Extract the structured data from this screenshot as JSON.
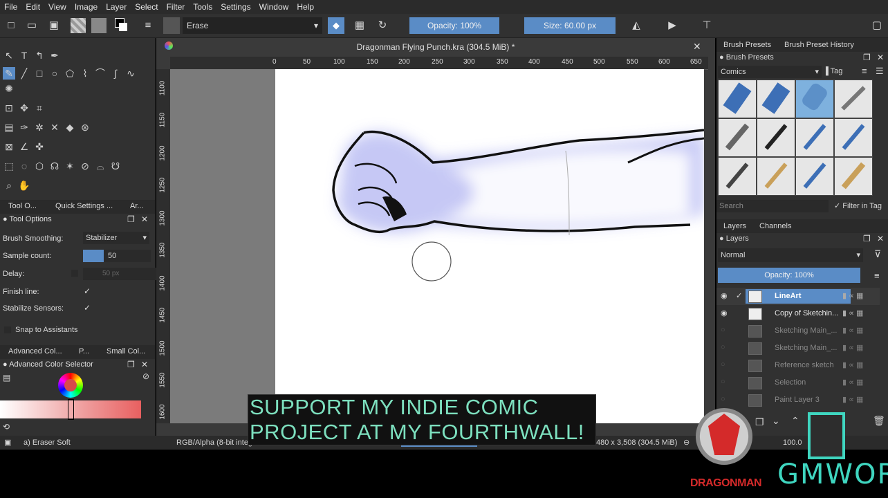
{
  "menu": [
    "File",
    "Edit",
    "View",
    "Image",
    "Layer",
    "Select",
    "Filter",
    "Tools",
    "Settings",
    "Window",
    "Help"
  ],
  "toolbar": {
    "blend_mode": "Erase",
    "opacity": "Opacity: 100%",
    "size_label": "Size:",
    "size_value": "60.00 px"
  },
  "document": {
    "title": "Dragonman Flying Punch.kra (304.5 MiB) *"
  },
  "rulers": {
    "h_ticks": [
      "0",
      "50",
      "100",
      "150",
      "200",
      "250",
      "300",
      "350",
      "400",
      "450",
      "500",
      "550",
      "600",
      "650"
    ],
    "v_ticks": [
      "1100",
      "1150",
      "1200",
      "1250",
      "1300",
      "1350",
      "1400",
      "1450",
      "1500",
      "1550",
      "1600"
    ]
  },
  "left_panel": {
    "tabs": [
      "Tool O...",
      "Quick Settings ...",
      "Ar..."
    ],
    "tool_options_title": "Tool Options",
    "brush_smoothing_label": "Brush Smoothing:",
    "brush_smoothing_value": "Stabilizer",
    "sample_count_label": "Sample count:",
    "sample_count_value": "50",
    "delay_label": "Delay:",
    "delay_value": "50 px",
    "finish_line_label": "Finish line:",
    "stabilize_sensors_label": "Stabilize Sensors:",
    "snap_label": "Snap to Assistants",
    "color_tabs": [
      "Advanced Col...",
      "P...",
      "Small Col..."
    ],
    "color_selector_title": "Advanced Color Selector"
  },
  "right_panel": {
    "tabs": [
      "Brush Presets",
      "Brush Preset History"
    ],
    "brush_presets_title": "Brush Presets",
    "preset_tag": "Comics",
    "tag_label": "Tag",
    "search_placeholder": "Search",
    "filter_in_tag": "Filter in Tag",
    "layer_tabs": [
      "Layers",
      "Channels"
    ],
    "layers_title": "Layers",
    "blend_mode": "Normal",
    "opacity": "Opacity:  100%",
    "layers": [
      {
        "name": "LineArt",
        "visible": true,
        "active": true
      },
      {
        "name": "Copy of Sketchin...",
        "visible": true,
        "active": false
      },
      {
        "name": "Sketching Main_...",
        "visible": false,
        "active": false
      },
      {
        "name": "Sketching Main_...",
        "visible": false,
        "active": false
      },
      {
        "name": "Reference sketch",
        "visible": false,
        "active": false
      },
      {
        "name": "Selection",
        "visible": false,
        "active": false
      },
      {
        "name": "Paint Layer 3",
        "visible": false,
        "active": false
      }
    ]
  },
  "status": {
    "brush": "a) Eraser Soft",
    "color_space": "RGB/Alpha (8-bit integ",
    "dimensions": "480 x 3,508 (304.5 MiB)",
    "zoom": "100.0"
  },
  "overlay": {
    "line1": "SUPPORT MY INDIE COMIC",
    "line2": "PROJECT AT MY FOURTHWALL!",
    "logo1": "DRAGONMAN",
    "logo2": "GMWOR"
  },
  "colors": {
    "accent": "#5a8cc6",
    "caption_text": "#7de0bf",
    "logo_red": "#d42a2a",
    "logo_teal": "#3fd6c0"
  }
}
